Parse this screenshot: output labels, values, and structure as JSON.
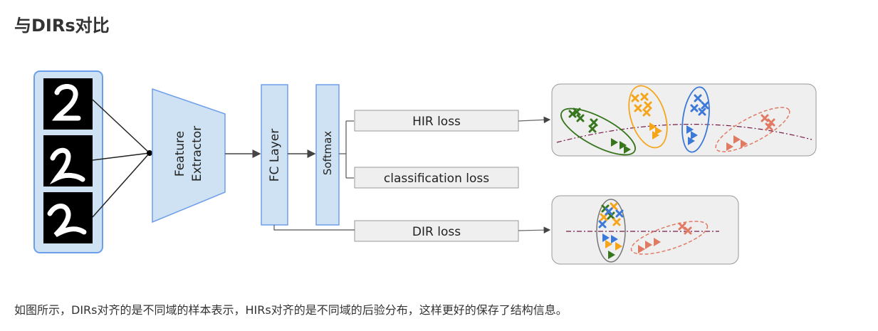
{
  "heading": "与DIRs对比",
  "diagram": {
    "feature_extractor": [
      "Feature",
      "Extractor"
    ],
    "fc_layer": "FC  Layer",
    "softmax": "Softmax",
    "hir_loss": "HIR loss",
    "classification_loss": "classification loss",
    "dir_loss": "DIR loss"
  },
  "caption": "如图所示，DIRs对齐的是不同域的样本表示，HIRs对齐的是不同域的后验分布，这样更好的保存了结构信息。",
  "colors": {
    "block_fill": "#cfe2f3",
    "block_stroke": "#6d9eeb",
    "panel_fill": "#efefef",
    "green": "#38761d",
    "orange": "#f6a51a",
    "blue": "#3c78d8",
    "salmon": "#e07a63"
  }
}
